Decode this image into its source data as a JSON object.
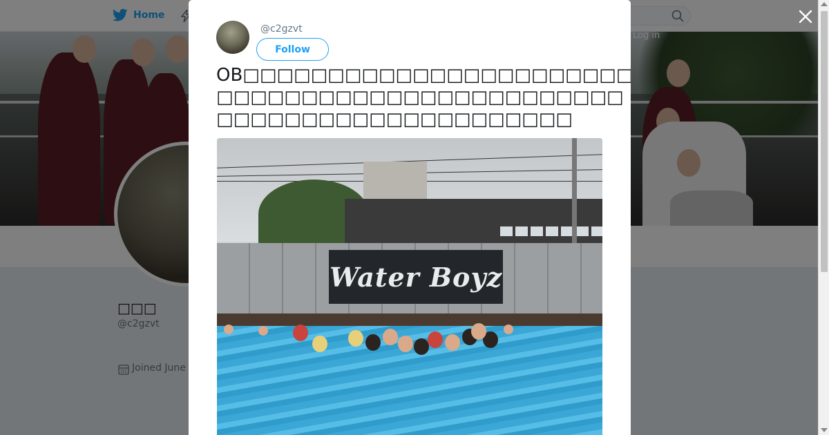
{
  "nav": {
    "home_label": "Home",
    "login_label": "Log in"
  },
  "profile": {
    "name": "□□□",
    "handle": "@c2gzvt",
    "joined": "Joined June"
  },
  "tweet": {
    "handle": "@c2gzvt",
    "follow_label": "Follow",
    "text": "OB□□□□□□□□□□□□□□□□□□□□□□□□□□□□□□□□□□□□□□□□□□□□□□□□□□□□□□□□□□□□□□□□□□□□□□□□□□",
    "photo_banner_text": "Water Boyz"
  },
  "colors": {
    "accent": "#1da1f2",
    "text_primary": "#14171a",
    "text_secondary": "#657786"
  }
}
